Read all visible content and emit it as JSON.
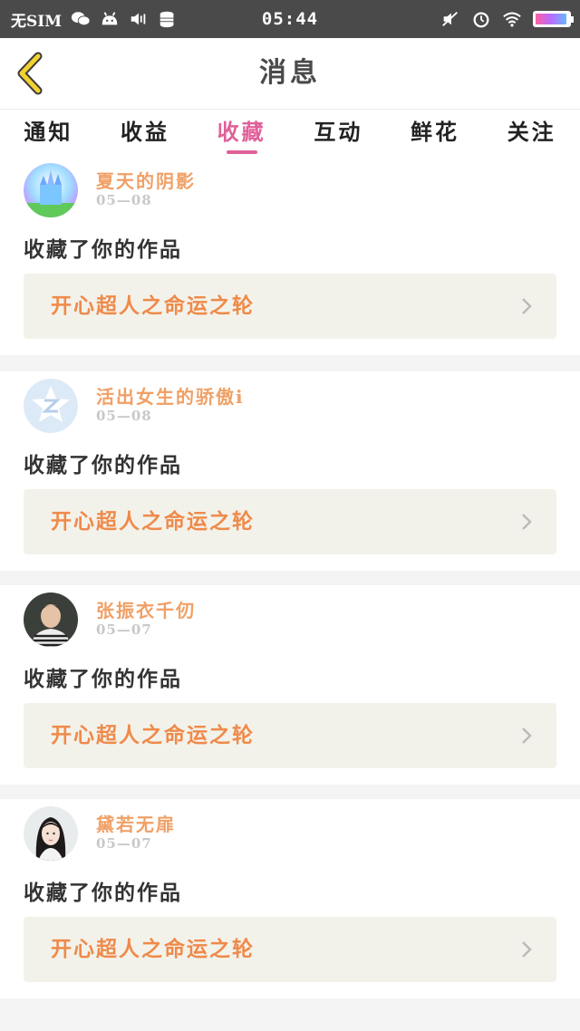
{
  "status_bar": {
    "carrier": "无SIM",
    "time": "05:44"
  },
  "header": {
    "title": "消息"
  },
  "tabs": [
    {
      "label": "通知",
      "active": false
    },
    {
      "label": "收益",
      "active": false
    },
    {
      "label": "收藏",
      "active": true
    },
    {
      "label": "互动",
      "active": false
    },
    {
      "label": "鲜花",
      "active": false
    },
    {
      "label": "关注",
      "active": false
    }
  ],
  "items": [
    {
      "username": "夏天的阴影",
      "date": "05—08",
      "action": "收藏了你的作品",
      "work": "开心超人之命运之轮",
      "avatar": "castle"
    },
    {
      "username": "活出女生的骄傲i",
      "date": "05—08",
      "action": "收藏了你的作品",
      "work": "开心超人之命运之轮",
      "avatar": "default-z"
    },
    {
      "username": "张振衣千仞",
      "date": "05—07",
      "action": "收藏了你的作品",
      "work": "开心超人之命运之轮",
      "avatar": "boy"
    },
    {
      "username": "黛若无扉",
      "date": "05—07",
      "action": "收藏了你的作品",
      "work": "开心超人之命运之轮",
      "avatar": "girl"
    }
  ],
  "colors": {
    "accent_pink": "#e0609a",
    "username_orange": "#f0a066",
    "work_orange": "#ef8a4a",
    "back_arrow_yellow": "#f2d230"
  }
}
